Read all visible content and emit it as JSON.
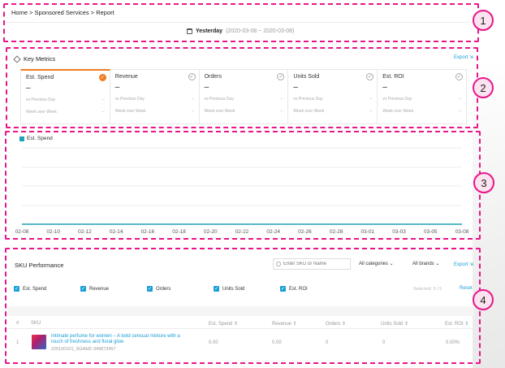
{
  "header": {
    "breadcrumb": "Home > Sponsored Services > Report",
    "date_label": "Yesterday",
    "date_range": "(2020-03-08 ~ 2020-03-08)"
  },
  "key_metrics": {
    "title": "Key Metrics",
    "export_label": "Export ⇲",
    "cards": [
      {
        "title": "Est. Spend",
        "value": "–",
        "vs_prev_day": "vs Previous Day",
        "vs_prev_day_val": "–",
        "wow": "Week over Week",
        "wow_val": "–",
        "selected": true
      },
      {
        "title": "Revenue",
        "value": "–",
        "vs_prev_day": "vs Previous Day",
        "vs_prev_day_val": "–",
        "wow": "Week over Week",
        "wow_val": "–",
        "selected": false
      },
      {
        "title": "Orders",
        "value": "–",
        "vs_prev_day": "vs Previous Day",
        "vs_prev_day_val": "–",
        "wow": "Week over Week",
        "wow_val": "–",
        "selected": false
      },
      {
        "title": "Units Sold",
        "value": "–",
        "vs_prev_day": "vs Previous Day",
        "vs_prev_day_val": "–",
        "wow": "Week over Week",
        "wow_val": "–",
        "selected": false
      },
      {
        "title": "Est. ROI",
        "value": "–",
        "vs_prev_day": "vs Previous Day",
        "vs_prev_day_val": "–",
        "wow": "Week over Week",
        "wow_val": "–",
        "selected": false
      }
    ]
  },
  "trend": {
    "legend": "Est. Spend",
    "series_color": "#1fa2b6",
    "x_labels": [
      "02-08",
      "02-10",
      "02-12",
      "02-14",
      "02-16",
      "02-18",
      "02-20",
      "02-22",
      "02-24",
      "02-26",
      "02-28",
      "03-01",
      "03-03",
      "03-05",
      "03-08"
    ]
  },
  "sku": {
    "title": "SKU Performance",
    "search_placeholder": "Enter SKU or Name",
    "category_filter": "All categories ⌄",
    "brand_filter": "All brands ⌄",
    "export_label": "Export ⇲",
    "checkboxes": [
      "Est. Spend",
      "Revenue",
      "Orders",
      "Units Sold",
      "Est. ROI"
    ],
    "selected_text": "Selected: 5 / 5",
    "reset_label": "Reset",
    "columns": [
      "#",
      "SKU",
      "Est. Spend ⇕",
      "Revenue ⇕",
      "Orders ⇕",
      "Units Sold ⇕",
      "Est. ROI ⇕"
    ],
    "rows": [
      {
        "index": "1",
        "name": "Intimate perfume for women – A bold sensual mixture with a touch of freshness and floral glow",
        "id": "225100101_SGAMZ-349873457",
        "spend": "0.00",
        "revenue": "0.00",
        "orders": "0",
        "units": "0",
        "roi": "0.00%"
      }
    ]
  },
  "annotations": [
    "1",
    "2",
    "3",
    "4"
  ]
}
